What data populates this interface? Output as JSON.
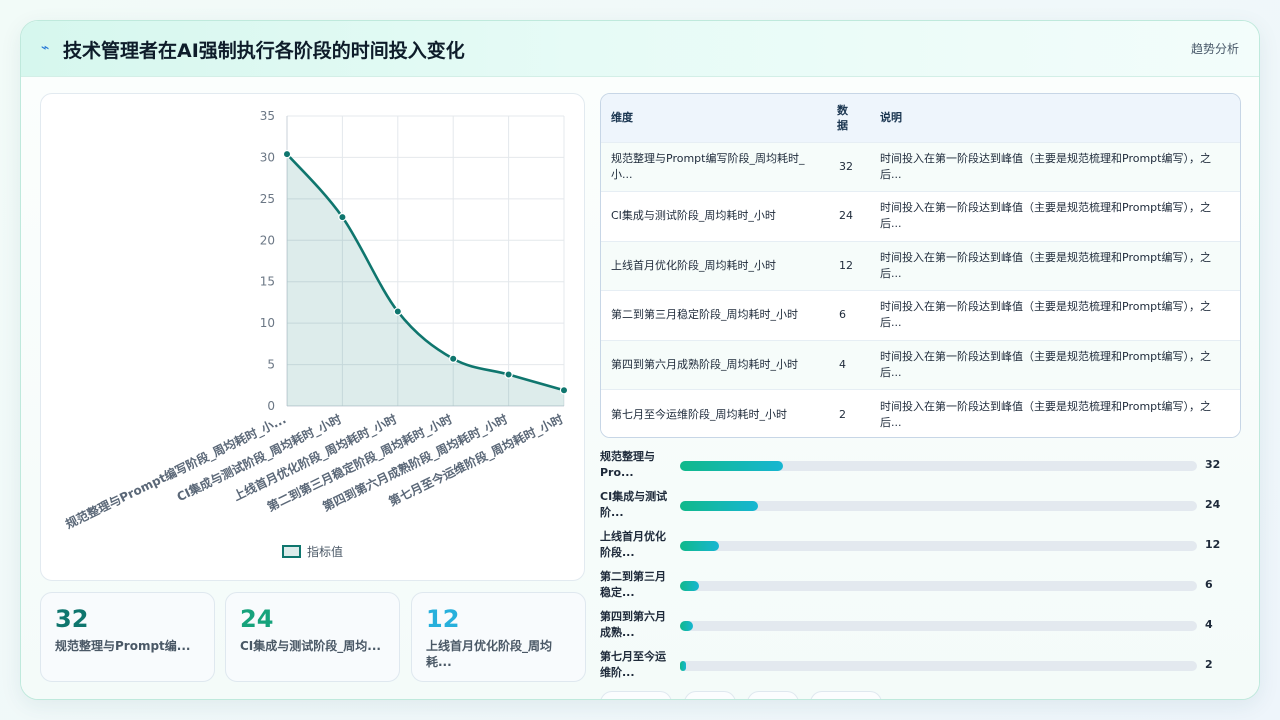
{
  "header": {
    "title": "技术管理者在AI强制执行各阶段的时间投入变化",
    "action": "趋势分析",
    "logo_icon": "lightning-icon"
  },
  "chart_data": {
    "type": "line",
    "categories": [
      "规范整理与Prompt编写阶段_周均耗时_小...",
      "CI集成与测试阶段_周均耗时_小时",
      "上线首月优化阶段_周均耗时_小时",
      "第二到第三月稳定阶段_周均耗时_小时",
      "第四到第六月成熟阶段_周均耗时_小时",
      "第七月至今运维阶段_周均耗时_小时"
    ],
    "series": [
      {
        "name": "指标值",
        "values": [
          30.4,
          22.8,
          11.4,
          5.7,
          3.8,
          1.9
        ]
      }
    ],
    "ylim": [
      0,
      35
    ],
    "yticks": [
      0,
      5,
      10,
      15,
      20,
      25,
      30,
      35
    ],
    "fill": true,
    "grid": true,
    "legend": "bottom",
    "color": "#0f766e"
  },
  "stats": [
    {
      "value": "32",
      "label": "规范整理与Prompt编...",
      "color": "#0f766e"
    },
    {
      "value": "24",
      "label": "CI集成与测试阶段_周均...",
      "color": "#16a37c"
    },
    {
      "value": "12",
      "label": "上线首月优化阶段_周均耗...",
      "color": "#27b0dc"
    }
  ],
  "table": {
    "headers": {
      "dimension": "维度",
      "data": "数据",
      "desc": "说明"
    },
    "rows": [
      {
        "dimension": "规范整理与Prompt编写阶段_周均耗时_小...",
        "data": "32",
        "desc": "时间投入在第一阶段达到峰值（主要是规范梳理和Prompt编写），之后..."
      },
      {
        "dimension": "CI集成与测试阶段_周均耗时_小时",
        "data": "24",
        "desc": "时间投入在第一阶段达到峰值（主要是规范梳理和Prompt编写），之后..."
      },
      {
        "dimension": "上线首月优化阶段_周均耗时_小时",
        "data": "12",
        "desc": "时间投入在第一阶段达到峰值（主要是规范梳理和Prompt编写），之后..."
      },
      {
        "dimension": "第二到第三月稳定阶段_周均耗时_小时",
        "data": "6",
        "desc": "时间投入在第一阶段达到峰值（主要是规范梳理和Prompt编写），之后..."
      },
      {
        "dimension": "第四到第六月成熟阶段_周均耗时_小时",
        "data": "4",
        "desc": "时间投入在第一阶段达到峰值（主要是规范梳理和Prompt编写），之后..."
      },
      {
        "dimension": "第七月至今运维阶段_周均耗时_小时",
        "data": "2",
        "desc": "时间投入在第一阶段达到峰值（主要是规范梳理和Prompt编写），之后..."
      }
    ]
  },
  "bars": {
    "max": 160,
    "items": [
      {
        "label": "规范整理与Pro...",
        "value": 32
      },
      {
        "label": "CI集成与测试阶...",
        "value": 24
      },
      {
        "label": "上线首月优化阶段...",
        "value": 12
      },
      {
        "label": "第二到第三月稳定...",
        "value": 6
      },
      {
        "label": "第四到第六月成熟...",
        "value": 4
      },
      {
        "label": "第七月至今运维阶...",
        "value": 2
      }
    ]
  }
}
